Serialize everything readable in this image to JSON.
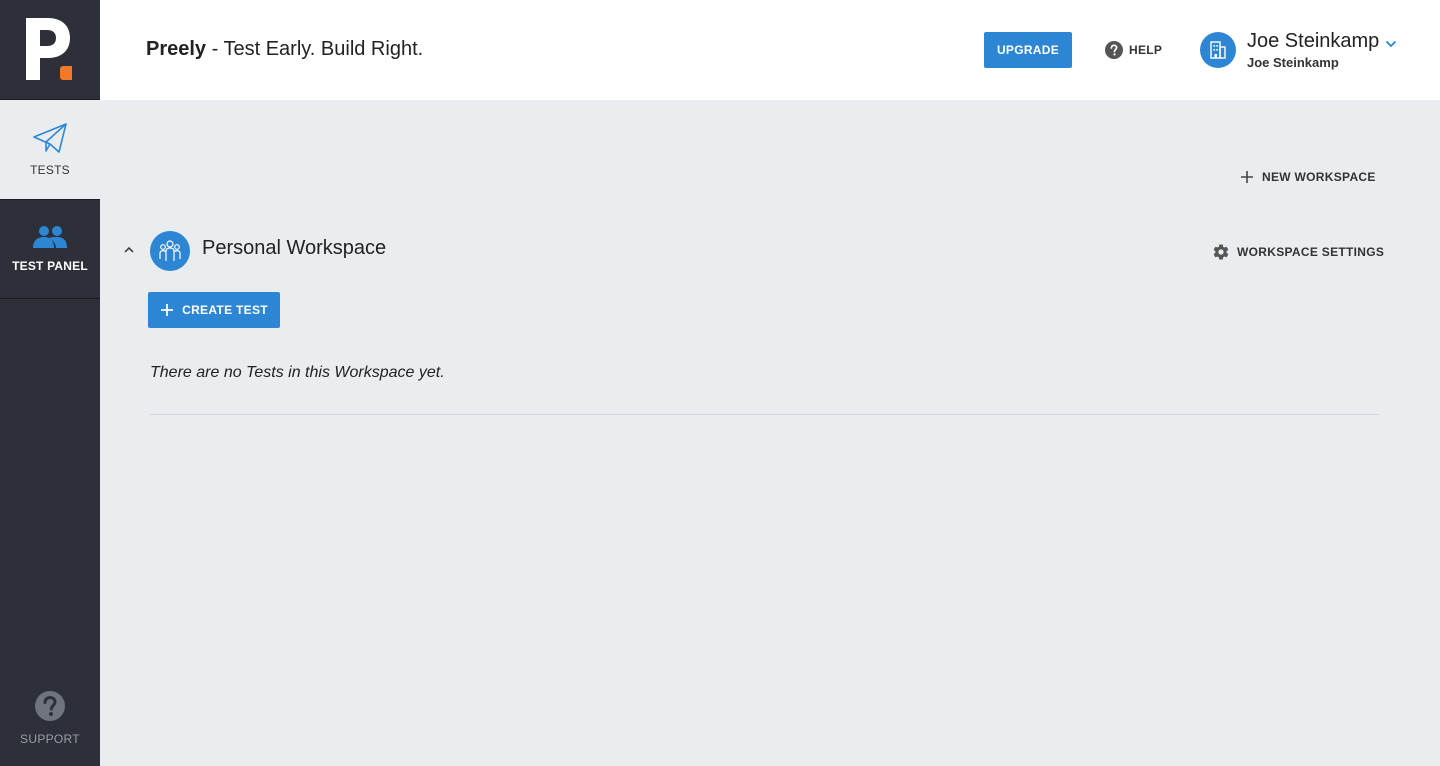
{
  "app": {
    "brand_name": "Preely",
    "tagline": " - Test Early. Build Right.",
    "accent_color": "#2d86d4",
    "logo_accent_color": "#f07a28"
  },
  "sidebar": {
    "items": [
      {
        "label": "TESTS",
        "icon": "paper-plane-icon",
        "active": true
      },
      {
        "label": "TEST PANEL",
        "icon": "people-icon",
        "active": false
      }
    ],
    "support_label": "SUPPORT"
  },
  "header": {
    "upgrade_label": "UPGRADE",
    "help_label": "HELP",
    "user_name": "Joe Steinkamp",
    "user_subtitle": "Joe Steinkamp"
  },
  "main": {
    "new_workspace_label": "NEW WORKSPACE",
    "workspace": {
      "title": "Personal Workspace",
      "settings_label": "WORKSPACE SETTINGS",
      "create_test_label": "CREATE TEST",
      "empty_message": "There are no Tests in this Workspace yet."
    }
  }
}
